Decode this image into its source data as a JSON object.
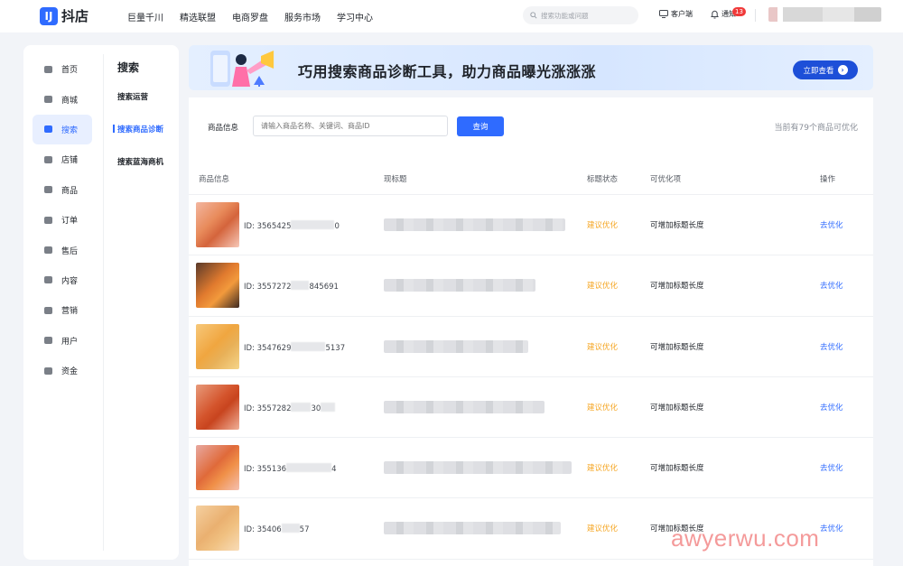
{
  "app": {
    "logo_mark": "IJ",
    "logo_text": "抖店"
  },
  "topnav": [
    "巨量千川",
    "精选联盟",
    "电商罗盘",
    "服务市场",
    "学习中心"
  ],
  "search": {
    "placeholder": "搜索功能或问题"
  },
  "top_right": {
    "client_label": "客户端",
    "notice_label": "通知",
    "notice_count": "13"
  },
  "sidebar": {
    "items": [
      {
        "label": "首页",
        "icon": "home-icon"
      },
      {
        "label": "商城",
        "icon": "mall-icon"
      },
      {
        "label": "搜索",
        "icon": "search-nav-icon",
        "active": true
      },
      {
        "label": "店铺",
        "icon": "shop-icon"
      },
      {
        "label": "商品",
        "icon": "product-icon"
      },
      {
        "label": "订单",
        "icon": "order-icon"
      },
      {
        "label": "售后",
        "icon": "aftersale-icon"
      },
      {
        "label": "内容",
        "icon": "content-icon"
      },
      {
        "label": "营销",
        "icon": "marketing-icon"
      },
      {
        "label": "用户",
        "icon": "user-icon"
      },
      {
        "label": "资金",
        "icon": "funds-icon"
      }
    ],
    "section_title": "搜索",
    "sub_items": [
      "搜索运营",
      "搜索商品诊断",
      "搜索蓝海商机"
    ],
    "active_sub": "搜索商品诊断"
  },
  "banner": {
    "title": "巧用搜索商品诊断工具，助力商品曝光涨涨涨",
    "button": "立即查看"
  },
  "filter": {
    "label": "商品信息",
    "placeholder": "请输入商品名称、关键词、商品ID",
    "button": "查询",
    "count_text": "当前有79个商品可优化"
  },
  "table": {
    "headers": [
      "商品信息",
      "现标题",
      "标题状态",
      "可优化项",
      "操作"
    ],
    "rows": [
      {
        "id_prefix": "ID: 3565425",
        "id_suffix": "0",
        "status": "建议优化",
        "optimize": "可增加标题长度",
        "action": "去优化"
      },
      {
        "id_prefix": "ID: 3557272",
        "id_suffix": "845691",
        "status": "建议优化",
        "optimize": "可增加标题长度",
        "action": "去优化"
      },
      {
        "id_prefix": "ID: 3547629",
        "id_suffix": "5137",
        "status": "建议优化",
        "optimize": "可增加标题长度",
        "action": "去优化"
      },
      {
        "id_prefix": "ID: 3557282",
        "id_suffix": "30",
        "status": "建议优化",
        "optimize": "可增加标题长度",
        "action": "去优化"
      },
      {
        "id_prefix": "ID: 355136",
        "id_suffix": "4",
        "status": "建议优化",
        "optimize": "可增加标题长度",
        "action": "去优化"
      },
      {
        "id_prefix": "ID: 35406",
        "id_suffix": "57",
        "status": "建议优化",
        "optimize": "可增加标题长度",
        "action": "去优化"
      }
    ]
  },
  "watermark": "awyerwu.com"
}
